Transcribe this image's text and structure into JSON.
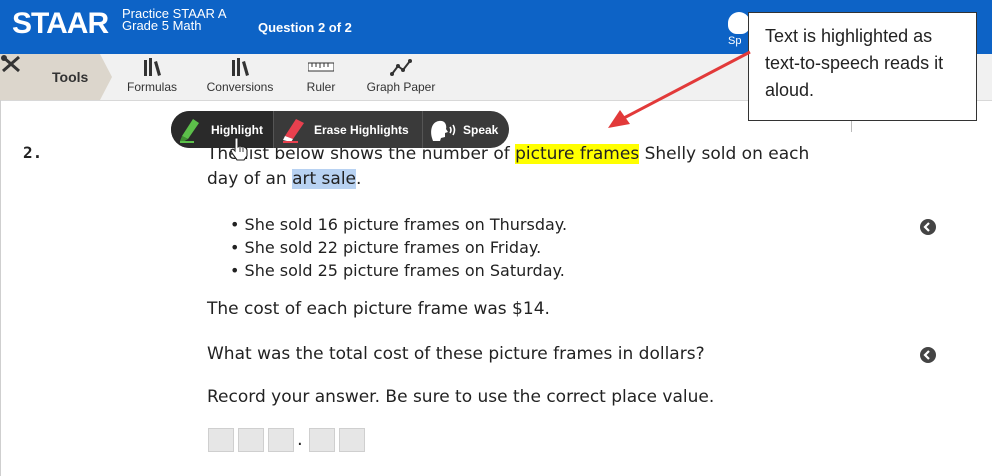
{
  "header": {
    "logo": "STAAR",
    "test_name_line1": "Practice STAAR A",
    "test_name_line2": "Grade 5 Math",
    "question_count": "Question 2 of 2",
    "background_color": "#0d63c6"
  },
  "toolbar": {
    "tools_label": "Tools",
    "items": [
      {
        "label": "Formulas",
        "icon": "formulas-icon"
      },
      {
        "label": "Conversions",
        "icon": "conversions-icon"
      },
      {
        "label": "Ruler",
        "icon": "ruler-icon"
      },
      {
        "label": "Graph Paper",
        "icon": "graph-paper-icon"
      }
    ]
  },
  "highlight_toolbar": {
    "highlight_label": "Highlight",
    "erase_label": "Erase Highlights",
    "speak_label": "Speak"
  },
  "question": {
    "number": "2.",
    "intro_part1": "The list below shows the number of ",
    "intro_highlight_yellow": "picture frames",
    "intro_part2": " Shelly sold on each",
    "intro_line2_part1": "day of an ",
    "intro_highlight_blue": "art sale",
    "intro_line2_part2": ".",
    "bullets": [
      "She sold 16 picture frames on Thursday.",
      "She sold 22 picture frames on Friday.",
      "She sold 25 picture frames on Saturday."
    ],
    "cost_line": "The cost of each picture frame was $14.",
    "prompt": "What was the total cost of these picture frames in dollars?",
    "instruction": "Record your answer. Be sure to use the correct place value.",
    "answer_decimal_point": "."
  },
  "callout": {
    "text": "Text is highlighted as text-to-speech reads it aloud.",
    "arrow_color": "#e23a3a"
  },
  "colors": {
    "highlight_yellow": "#ffff00",
    "highlight_blue": "#b8d2f2",
    "toolbar_dark": "#3a3a3a"
  }
}
